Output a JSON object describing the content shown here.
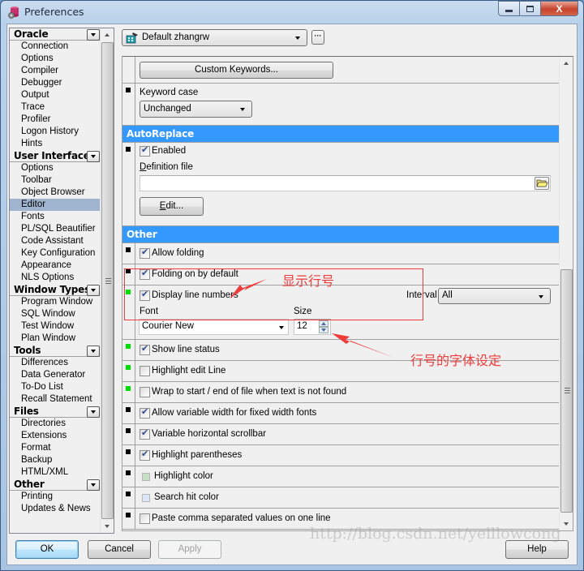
{
  "window": {
    "title": "Preferences",
    "caption_buttons": {
      "minimize": "—",
      "maximize": "▢",
      "close": "X"
    }
  },
  "sidebar": {
    "groups": [
      {
        "label": "Oracle",
        "items": [
          {
            "label": "Connection"
          },
          {
            "label": "Options"
          },
          {
            "label": "Compiler"
          },
          {
            "label": "Debugger"
          },
          {
            "label": "Output"
          },
          {
            "label": "Trace"
          },
          {
            "label": "Profiler"
          },
          {
            "label": "Logon History"
          },
          {
            "label": "Hints"
          }
        ]
      },
      {
        "label": "User Interface",
        "items": [
          {
            "label": "Options"
          },
          {
            "label": "Toolbar"
          },
          {
            "label": "Object Browser"
          },
          {
            "label": "Editor",
            "selected": true
          },
          {
            "label": "Fonts"
          },
          {
            "label": "PL/SQL Beautifier"
          },
          {
            "label": "Code Assistant"
          },
          {
            "label": "Key Configuration"
          },
          {
            "label": "Appearance"
          },
          {
            "label": "NLS Options"
          }
        ]
      },
      {
        "label": "Window Types",
        "items": [
          {
            "label": "Program Window"
          },
          {
            "label": "SQL Window"
          },
          {
            "label": "Test Window"
          },
          {
            "label": "Plan Window"
          }
        ]
      },
      {
        "label": "Tools",
        "items": [
          {
            "label": "Differences"
          },
          {
            "label": "Data Generator"
          },
          {
            "label": "To-Do List"
          },
          {
            "label": "Recall Statement"
          }
        ]
      },
      {
        "label": "Files",
        "items": [
          {
            "label": "Directories"
          },
          {
            "label": "Extensions"
          },
          {
            "label": "Format"
          },
          {
            "label": "Backup"
          },
          {
            "label": "HTML/XML"
          }
        ]
      },
      {
        "label": "Other",
        "items": [
          {
            "label": "Printing"
          },
          {
            "label": "Updates & News"
          }
        ]
      }
    ]
  },
  "profile": {
    "selected": "Default zhangrw",
    "more_label": "···"
  },
  "settings": {
    "custom_keywords_button": "Custom Keywords...",
    "keyword_case": {
      "label": "Keyword case",
      "value": "Unchanged"
    },
    "autoreplace": {
      "header": "AutoReplace",
      "enabled": {
        "label": "Enabled",
        "checked": true
      },
      "definition_file": {
        "label": "Definition file",
        "value": ""
      },
      "edit_button": "Edit..."
    },
    "other": {
      "header": "Other",
      "allow_folding": {
        "label": "Allow folding",
        "checked": true
      },
      "folding_default": {
        "label": "Folding on by default",
        "checked": true
      },
      "display_line_numbers": {
        "label": "Display line numbers",
        "checked": true
      },
      "interval": {
        "label": "Interval",
        "value": "All"
      },
      "font": {
        "label": "Font",
        "value": "Courier New"
      },
      "size": {
        "label": "Size",
        "value": "12"
      },
      "show_line_status": {
        "label": "Show line status",
        "checked": true
      },
      "highlight_edit_line": {
        "label": "Highlight edit Line",
        "checked": false
      },
      "wrap_search": {
        "label": "Wrap to start / end of file when text is not found",
        "checked": false
      },
      "variable_width": {
        "label": "Allow variable width for fixed width fonts",
        "checked": true
      },
      "variable_hscroll": {
        "label": "Variable horizontal scrollbar",
        "checked": true
      },
      "highlight_parens": {
        "label": "Highlight parentheses",
        "checked": true
      },
      "highlight_color": {
        "label": "Highlight color",
        "color": "#c8e0c8"
      },
      "search_hit_color": {
        "label": "Search hit color",
        "color": "#dce6f8"
      },
      "paste_csv": {
        "label": "Paste comma separated values on one line",
        "checked": false
      }
    }
  },
  "annotations": {
    "line_numbers_note": "显示行号",
    "font_note": "行号的字体设定",
    "color": "#ee3b3b"
  },
  "buttons": {
    "ok": "OK",
    "cancel": "Cancel",
    "apply": "Apply",
    "help": "Help"
  },
  "watermark": "http://blog.csdn.net/yelllowcong"
}
